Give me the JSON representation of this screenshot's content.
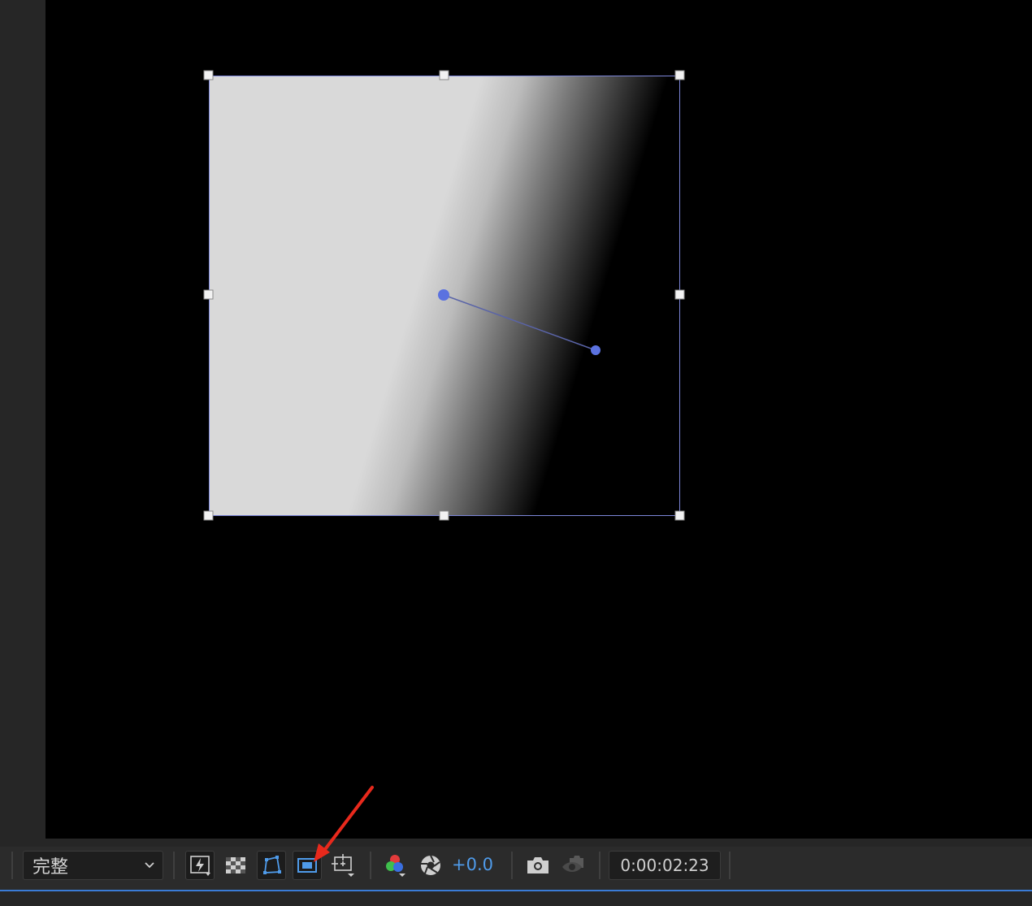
{
  "toolbar": {
    "resolution": {
      "value": "完整",
      "icon": "chevron-down-icon"
    },
    "buttons": [
      {
        "name": "fast-previews-button",
        "icon": "lightning-icon",
        "active": false
      },
      {
        "name": "transparency-grid-button",
        "icon": "checkerboard-icon",
        "active": false
      },
      {
        "name": "mask-visibility-button",
        "icon": "mask-path-icon",
        "active": true
      },
      {
        "name": "region-of-interest-button",
        "icon": "region-of-interest-icon",
        "active": true
      },
      {
        "name": "grid-guides-button",
        "icon": "grid-guides-icon",
        "active": false
      },
      {
        "name": "channel-button",
        "icon": "rgb-channels-icon",
        "active": false
      },
      {
        "name": "reset-exposure-button",
        "icon": "aperture-icon",
        "active": false
      },
      {
        "name": "snapshot-button",
        "icon": "camera-icon",
        "active": false
      },
      {
        "name": "show-snapshot-button",
        "icon": "show-snapshot-icon",
        "active": false
      }
    ],
    "exposure": "+0.0",
    "timecode": "0:00:02:23"
  },
  "colors": {
    "accent": "#4f9bea",
    "bounding_box": "#7c86d8",
    "annotation_arrow": "#e8291c",
    "viewer_background": "#000000",
    "toolbar_background": "#2b2b2b"
  }
}
